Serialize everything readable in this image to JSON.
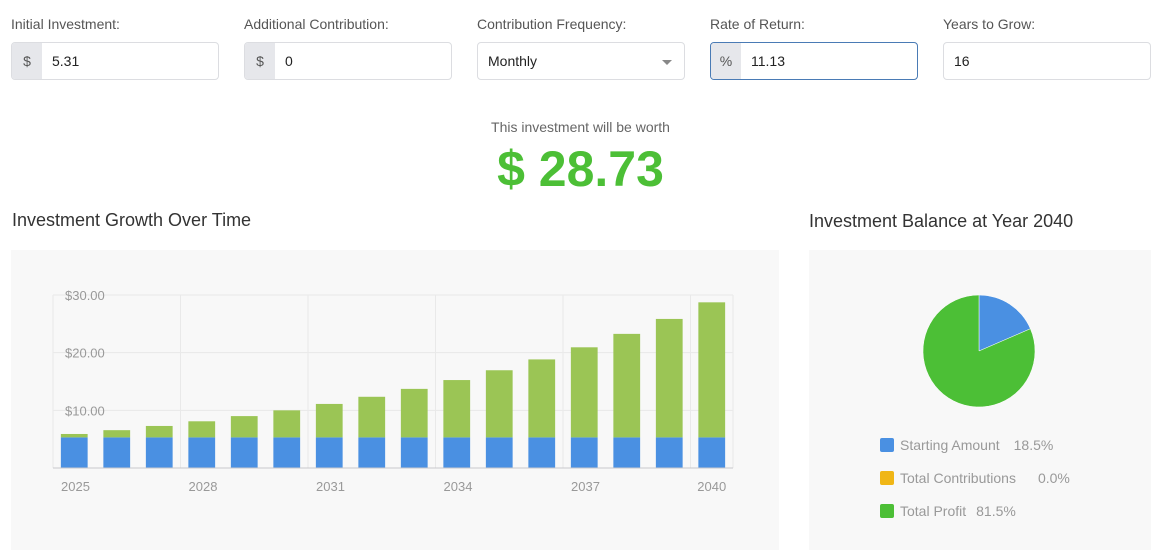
{
  "inputs": {
    "initial_investment": {
      "label": "Initial Investment:",
      "addon": "$",
      "value": "5.31"
    },
    "additional_contribution": {
      "label": "Additional Contribution:",
      "addon": "$",
      "value": "0"
    },
    "contribution_frequency": {
      "label": "Contribution Frequency:",
      "value": "Monthly"
    },
    "rate_of_return": {
      "label": "Rate of Return:",
      "addon": "%",
      "value": "11.13"
    },
    "years_to_grow": {
      "label": "Years to Grow:",
      "value": "16"
    }
  },
  "result": {
    "label": "This investment will be worth",
    "value": "$ 28.73"
  },
  "colors": {
    "starting": "#4a90e2",
    "contributions": "#f0b616",
    "profit_bar": "#9bc555",
    "profit_pie": "#4cbf36"
  },
  "chart_data": [
    {
      "type": "bar",
      "title": "Investment Growth Over Time",
      "stacked": true,
      "categories": [
        "2025",
        "2026",
        "2027",
        "2028",
        "2029",
        "2030",
        "2031",
        "2032",
        "2033",
        "2034",
        "2035",
        "2036",
        "2037",
        "2038",
        "2039",
        "2040"
      ],
      "x_tick_labels": [
        "2025",
        "2028",
        "2031",
        "2034",
        "2037",
        "2040"
      ],
      "y_tick_labels": [
        "$10.00",
        "$20.00",
        "$30.00"
      ],
      "ylim": [
        0,
        30
      ],
      "grid": true,
      "series": [
        {
          "name": "Starting Amount",
          "values": [
            5.31,
            5.31,
            5.31,
            5.31,
            5.31,
            5.31,
            5.31,
            5.31,
            5.31,
            5.31,
            5.31,
            5.31,
            5.31,
            5.31,
            5.31,
            5.31
          ]
        },
        {
          "name": "Total Profit",
          "values": [
            0.59,
            1.25,
            1.98,
            2.79,
            3.69,
            4.69,
            5.8,
            7.04,
            8.41,
            9.94,
            11.64,
            13.52,
            15.62,
            17.95,
            20.54,
            23.42
          ]
        }
      ]
    },
    {
      "type": "pie",
      "title": "Investment Balance at Year 2040",
      "legend": "bottom",
      "slices": [
        {
          "name": "Starting Amount",
          "value": 18.5,
          "label": "18.5%"
        },
        {
          "name": "Total Contributions",
          "value": 0.0,
          "label": "0.0%"
        },
        {
          "name": "Total Profit",
          "value": 81.5,
          "label": "81.5%"
        }
      ]
    }
  ]
}
